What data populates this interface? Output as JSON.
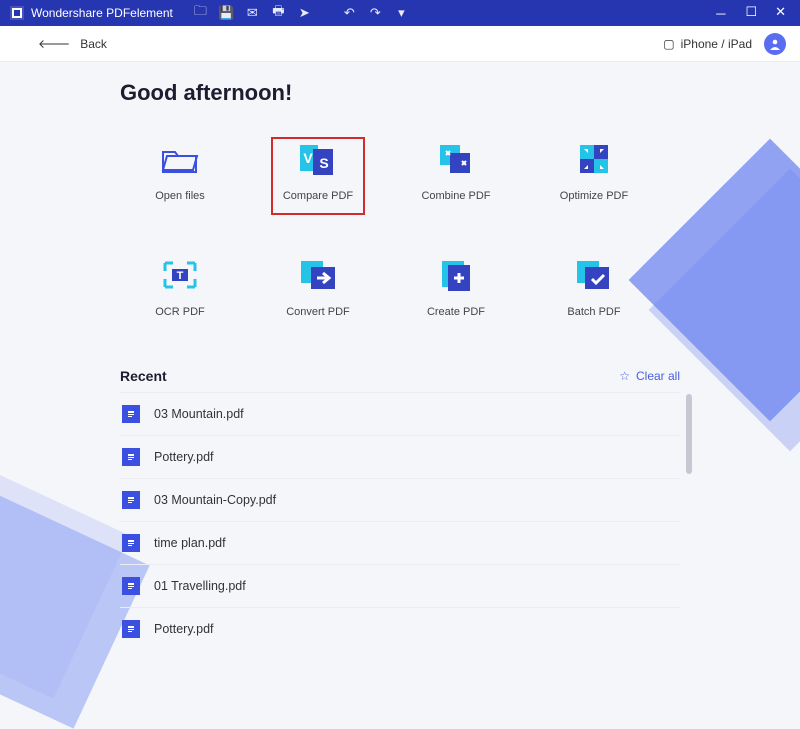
{
  "titlebar": {
    "app_name": "Wondershare PDFelement",
    "icons": [
      "folder",
      "save",
      "mail",
      "print",
      "send",
      "undo",
      "redo",
      "more"
    ]
  },
  "wincontrols": {
    "min": "－",
    "max": "☐",
    "close": "✕"
  },
  "toolbar": {
    "back_label": "Back",
    "device_label": "iPhone / iPad"
  },
  "greeting": "Good afternoon!",
  "tiles": [
    {
      "id": "open-files",
      "label": "Open files",
      "icon": "folder-open",
      "highlight": false
    },
    {
      "id": "compare-pdf",
      "label": "Compare PDF",
      "icon": "vs",
      "highlight": true
    },
    {
      "id": "combine-pdf",
      "label": "Combine PDF",
      "icon": "combine",
      "highlight": false
    },
    {
      "id": "optimize-pdf",
      "label": "Optimize PDF",
      "icon": "optimize",
      "highlight": false
    },
    {
      "id": "ocr-pdf",
      "label": "OCR PDF",
      "icon": "ocr",
      "highlight": false
    },
    {
      "id": "convert-pdf",
      "label": "Convert PDF",
      "icon": "convert",
      "highlight": false
    },
    {
      "id": "create-pdf",
      "label": "Create PDF",
      "icon": "create",
      "highlight": false
    },
    {
      "id": "batch-pdf",
      "label": "Batch PDF",
      "icon": "batch",
      "highlight": false
    }
  ],
  "recent": {
    "title": "Recent",
    "clear_label": "Clear all",
    "items": [
      "03 Mountain.pdf",
      "Pottery.pdf",
      "03 Mountain-Copy.pdf",
      "time plan.pdf",
      "01 Travelling.pdf",
      "Pottery.pdf"
    ]
  },
  "colors": {
    "brand": "#2636b0",
    "accent": "#3b4fe0"
  }
}
